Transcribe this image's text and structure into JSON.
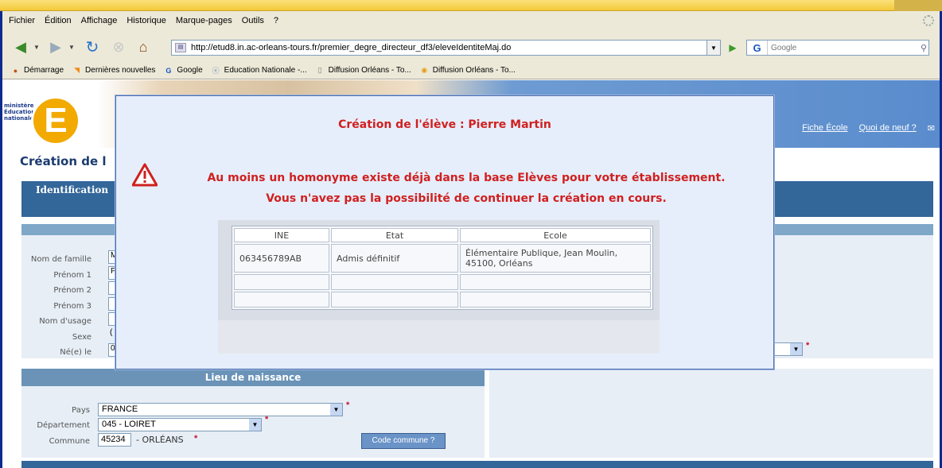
{
  "browser": {
    "menu": [
      "Fichier",
      "Édition",
      "Affichage",
      "Historique",
      "Marque-pages",
      "Outils",
      "?"
    ],
    "url": "http://etud8.in.ac-orleans-tours.fr/premier_degre_directeur_df3/eleveIdentiteMaj.do",
    "search_placeholder": "Google",
    "bookmarks": [
      "Démarrage",
      "Dernières nouvelles",
      "Google",
      "Education Nationale -...",
      "Diffusion Orléans - To...",
      "Diffusion Orléans - To..."
    ]
  },
  "header": {
    "logo_lines": [
      "ministère",
      "Éducation",
      "nationale"
    ],
    "logo_letter": "E",
    "links": [
      "Fiche École",
      "Quoi de neuf ?"
    ]
  },
  "page": {
    "title": "Création de l",
    "identification_tab": "Identification",
    "form_labels": [
      "Nom de famille",
      "Prénom 1",
      "Prénom 2",
      "Prénom 3",
      "Nom d'usage",
      "Sexe",
      "Né(e) le"
    ],
    "form_values": [
      "M",
      "P",
      "",
      "",
      "",
      "(",
      "0"
    ],
    "lieu": {
      "header": "Lieu de naissance",
      "pays_label": "Pays",
      "pays_value": "FRANCE",
      "departement_label": "Département",
      "departement_value": "045 - LOIRET",
      "commune_label": "Commune",
      "commune_value": "45234",
      "commune_name": "- ORLÉANS",
      "code_button": "Code commune ?"
    },
    "required_mark": "*"
  },
  "modal": {
    "title": "Création de l'élève : Pierre Martin",
    "message_line1": "Au moins un homonyme existe déjà dans la base Elèves pour votre établissement.",
    "message_line2": "Vous n'avez pas la possibilité de continuer la création en cours.",
    "table": {
      "headers": [
        "INE",
        "Etat",
        "Ecole"
      ],
      "rows": [
        [
          "063456789AB",
          "Admis définitif",
          "Élémentaire Publique, Jean Moulin, 45100, Orléans"
        ],
        [
          "",
          "",
          ""
        ],
        [
          "",
          "",
          ""
        ]
      ]
    }
  }
}
